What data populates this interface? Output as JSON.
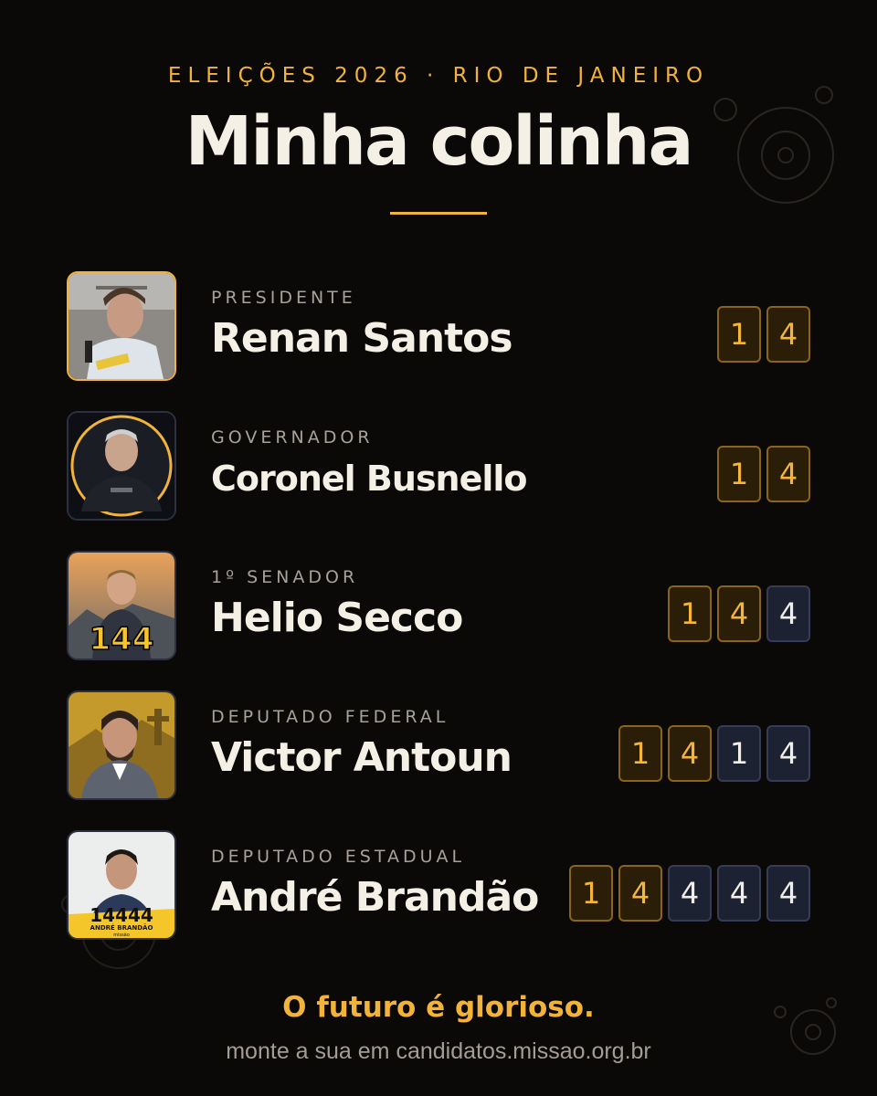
{
  "header": {
    "eyebrow": "ELEIÇÕES 2026 · RIO DE JANEIRO",
    "title": "Minha colinha"
  },
  "candidates": [
    {
      "role": "PRESIDENTE",
      "name": "Renan Santos",
      "party_digits": [
        "1",
        "4"
      ],
      "candidate_digits": []
    },
    {
      "role": "GOVERNADOR",
      "name": "Coronel Busnello",
      "party_digits": [
        "1",
        "4"
      ],
      "candidate_digits": []
    },
    {
      "role": "1º SENADOR",
      "name": "Helio Secco",
      "party_digits": [
        "1",
        "4"
      ],
      "candidate_digits": [
        "4"
      ],
      "photo_label": "144"
    },
    {
      "role": "DEPUTADO FEDERAL",
      "name": "Victor Antoun",
      "party_digits": [
        "1",
        "4"
      ],
      "candidate_digits": [
        "1",
        "4"
      ]
    },
    {
      "role": "DEPUTADO ESTADUAL",
      "name": "André Brandão",
      "party_digits": [
        "1",
        "4"
      ],
      "candidate_digits": [
        "4",
        "4",
        "4"
      ],
      "photo_label": "14444",
      "photo_sublabel": "ANDRÉ BRANDÃO",
      "photo_tag": "missão"
    }
  ],
  "footer": {
    "slogan": "O futuro é glorioso.",
    "cta": "monte a sua em candidatos.missao.org.br"
  },
  "colors": {
    "background": "#0b0908",
    "accent": "#f2b33a",
    "party_digit_bg": "#2a1e08",
    "candidate_digit_bg": "#1d2233"
  }
}
